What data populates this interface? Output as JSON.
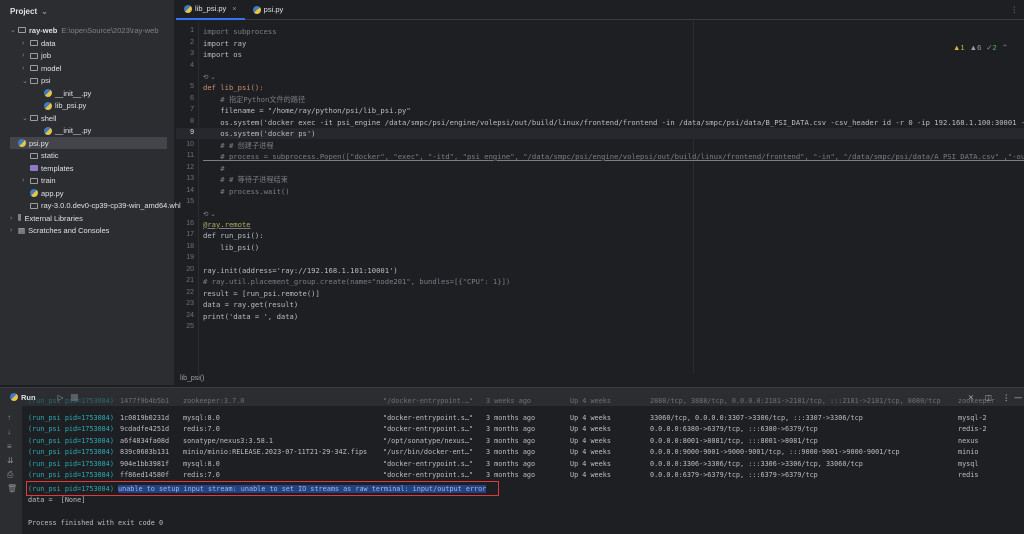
{
  "sidebar": {
    "title": "Project",
    "root": {
      "name": "ray-web",
      "path": "E:\\openSource\\2023\\ray-web"
    },
    "items": [
      "data",
      "job",
      "model",
      "psi",
      "__init__.py",
      "lib_psi.py",
      "shell",
      "__init__.py",
      "psi.py",
      "static",
      "templates",
      "train",
      "app.py",
      "ray-3.0.0.dev0-cp39-cp39-win_amd64.whl",
      "External Libraries",
      "Scratches and Consoles"
    ]
  },
  "tabs": [
    {
      "label": "lib_psi.py",
      "active": true
    },
    {
      "label": "psi.py",
      "active": false
    }
  ],
  "inspections": {
    "errors": "1",
    "warnings": "6",
    "ok": "2"
  },
  "code": {
    "lines": [
      "import subprocess",
      "import ray",
      "import os",
      "",
      "def lib_psi():",
      "    # 指定Python文件的路径",
      "    filename = \"/home/ray/python/psi/lib_psi.py\"",
      "    os.system('docker exec -it psi_engine /data/smpc/psi/engine/volepsi/out/build/linux/frontend/frontend -in /data/smpc/psi/data/B_PSI_DATA.csv -csv_header id -r 0 -ip 192.168.1.100:30001 -csv')",
      "    os.system('docker ps')",
      "    # # 创建子进程",
      "    # process = subprocess.Popen([\"docker\", \"exec\", \"-itd\", \"psi_engine\", \"/data/smpc/psi/engine/volepsi/out/build/linux/frontend/frontend\", \"-in\", \"/data/smpc/psi/data/A_PSI_DATA.csv\" ,\"-out\", \"/d",
      "    #",
      "    # # 等待子进程结束",
      "    # process.wait()",
      "",
      "@ray.remote",
      "def run_psi():",
      "    lib_psi()",
      "",
      "ray.init(address='ray://192.168.1.101:10001')",
      "# ray.util.placement_group.create(name=\"node201\", bundles=[{\"CPU\": 1}])",
      "result = [run_psi.remote()]",
      "data = ray.get(result)",
      "print('data = ', data)",
      ""
    ],
    "current_line": 9
  },
  "breadcrumb": "lib_psi()",
  "run": {
    "title": "Run",
    "rows": [
      [
        "(run_psi pid=1753084)",
        "1477f9b4b5b1",
        "zookeeper:3.7.0",
        "\"/docker-entrypoint.…\"",
        "3 weeks ago",
        "Up 4 weeks",
        "2888/tcp, 3888/tcp, 0.0.0.0:2181->2181/tcp, :::2181->2181/tcp, 8080/tcp",
        "zookeeper"
      ],
      [
        "(run_psi pid=1753084)",
        "1c0819b0231d",
        "mysql:8.0",
        "\"docker-entrypoint.s…\"",
        "3 months ago",
        "Up 4 weeks",
        "33060/tcp, 0.0.0.0:3307->3306/tcp, :::3307->3306/tcp",
        "mysql-2"
      ],
      [
        "(run_psi pid=1753084)",
        "9cdadfe4251d",
        "redis:7.0",
        "\"docker-entrypoint.s…\"",
        "3 months ago",
        "Up 4 weeks",
        "0.0.0.0:6380->6379/tcp, :::6380->6379/tcp",
        "redis-2"
      ],
      [
        "(run_psi pid=1753084)",
        "a6f4834fa08d",
        "sonatype/nexus3:3.58.1",
        "\"/opt/sonatype/nexus…\"",
        "3 months ago",
        "Up 4 weeks",
        "0.0.0.0:8001->8081/tcp, :::8001->8081/tcp",
        "nexus"
      ],
      [
        "(run_psi pid=1753084)",
        "839c0603b131",
        "minio/minio:RELEASE.2023-07-11T21-29-34Z.fips",
        "\"/usr/bin/docker-ent…\"",
        "3 months ago",
        "Up 4 weeks",
        "0.0.0.0:9000-9001->9000-9001/tcp, :::9000-9001->9000-9001/tcp",
        "minio"
      ],
      [
        "(run_psi pid=1753084)",
        "904e1bb3981f",
        "mysql:8.0",
        "\"docker-entrypoint.s…\"",
        "3 months ago",
        "Up 4 weeks",
        "0.0.0.0:3306->3306/tcp, :::3306->3306/tcp, 33060/tcp",
        "mysql"
      ],
      [
        "(run_psi pid=1753084)",
        "ff86ed14580f",
        "redis:7.0",
        "\"docker-entrypoint.s…\"",
        "3 months ago",
        "Up 4 weeks",
        "0.0.0.0:6379->6379/tcp, :::6379->6379/tcp",
        "redis"
      ]
    ],
    "error_prefix": "(run_psi pid=1753084)",
    "error_msg": "unable to setup input stream: unable to set IO streams as raw terminal: input/output error",
    "data_line": "data =  [None]",
    "exit_line": "Process finished with exit code 0"
  }
}
